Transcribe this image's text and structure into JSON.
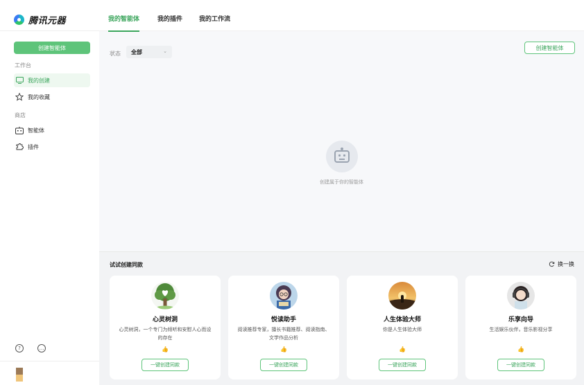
{
  "app": {
    "title": "腾讯元器"
  },
  "sidebar": {
    "create_label": "创建智能体",
    "workspace_label": "工作台",
    "items_workspace": [
      {
        "label": "我的创建",
        "icon": "monitor-icon",
        "active": true
      },
      {
        "label": "我的收藏",
        "icon": "star-icon",
        "active": false
      }
    ],
    "store_label": "商店",
    "items_store": [
      {
        "label": "智能体",
        "icon": "robot-icon"
      },
      {
        "label": "插件",
        "icon": "puzzle-icon"
      }
    ]
  },
  "tabs": [
    {
      "label": "我的智能体",
      "active": true
    },
    {
      "label": "我的插件",
      "active": false
    },
    {
      "label": "我的工作流",
      "active": false
    }
  ],
  "filter": {
    "label": "状态",
    "value": "全部"
  },
  "create_button": "创建智能体",
  "empty_state": {
    "text": "创建属于你的智能体"
  },
  "try_section": {
    "title": "试试创建同款",
    "refresh_label": "换一换",
    "cards": [
      {
        "name": "心灵树洞",
        "desc": "心灵树洞，一个专门为倾听和安慰人心而设的存在",
        "button": "一键创建同款"
      },
      {
        "name": "悦读助手",
        "desc": "阅读推荐专家，擅长书籍推荐、阅读指南、文学作品分析",
        "button": "一键创建同款"
      },
      {
        "name": "人生体验大师",
        "desc": "你是人生体验大师",
        "button": "一键创建同款"
      },
      {
        "name": "乐享向导",
        "desc": "生活娱乐伙伴，音乐影视分享",
        "button": "一键创建同款"
      }
    ]
  },
  "colors": {
    "accent": "#3ba55c",
    "accent_fill": "#5ec47a"
  }
}
